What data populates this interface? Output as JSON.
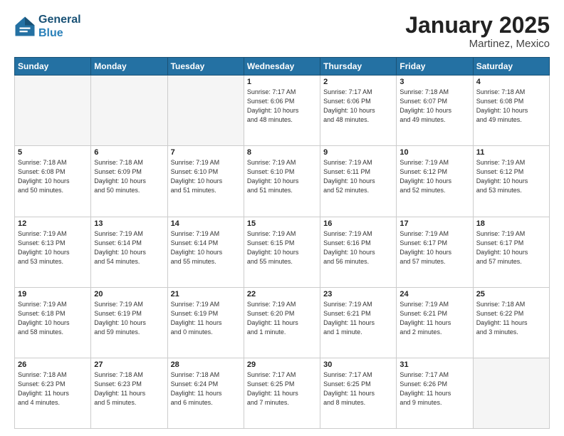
{
  "header": {
    "logo_line1": "General",
    "logo_line2": "Blue",
    "month": "January 2025",
    "location": "Martinez, Mexico"
  },
  "weekdays": [
    "Sunday",
    "Monday",
    "Tuesday",
    "Wednesday",
    "Thursday",
    "Friday",
    "Saturday"
  ],
  "weeks": [
    [
      {
        "day": "",
        "info": ""
      },
      {
        "day": "",
        "info": ""
      },
      {
        "day": "",
        "info": ""
      },
      {
        "day": "1",
        "info": "Sunrise: 7:17 AM\nSunset: 6:06 PM\nDaylight: 10 hours\nand 48 minutes."
      },
      {
        "day": "2",
        "info": "Sunrise: 7:17 AM\nSunset: 6:06 PM\nDaylight: 10 hours\nand 48 minutes."
      },
      {
        "day": "3",
        "info": "Sunrise: 7:18 AM\nSunset: 6:07 PM\nDaylight: 10 hours\nand 49 minutes."
      },
      {
        "day": "4",
        "info": "Sunrise: 7:18 AM\nSunset: 6:08 PM\nDaylight: 10 hours\nand 49 minutes."
      }
    ],
    [
      {
        "day": "5",
        "info": "Sunrise: 7:18 AM\nSunset: 6:08 PM\nDaylight: 10 hours\nand 50 minutes."
      },
      {
        "day": "6",
        "info": "Sunrise: 7:18 AM\nSunset: 6:09 PM\nDaylight: 10 hours\nand 50 minutes."
      },
      {
        "day": "7",
        "info": "Sunrise: 7:19 AM\nSunset: 6:10 PM\nDaylight: 10 hours\nand 51 minutes."
      },
      {
        "day": "8",
        "info": "Sunrise: 7:19 AM\nSunset: 6:10 PM\nDaylight: 10 hours\nand 51 minutes."
      },
      {
        "day": "9",
        "info": "Sunrise: 7:19 AM\nSunset: 6:11 PM\nDaylight: 10 hours\nand 52 minutes."
      },
      {
        "day": "10",
        "info": "Sunrise: 7:19 AM\nSunset: 6:12 PM\nDaylight: 10 hours\nand 52 minutes."
      },
      {
        "day": "11",
        "info": "Sunrise: 7:19 AM\nSunset: 6:12 PM\nDaylight: 10 hours\nand 53 minutes."
      }
    ],
    [
      {
        "day": "12",
        "info": "Sunrise: 7:19 AM\nSunset: 6:13 PM\nDaylight: 10 hours\nand 53 minutes."
      },
      {
        "day": "13",
        "info": "Sunrise: 7:19 AM\nSunset: 6:14 PM\nDaylight: 10 hours\nand 54 minutes."
      },
      {
        "day": "14",
        "info": "Sunrise: 7:19 AM\nSunset: 6:14 PM\nDaylight: 10 hours\nand 55 minutes."
      },
      {
        "day": "15",
        "info": "Sunrise: 7:19 AM\nSunset: 6:15 PM\nDaylight: 10 hours\nand 55 minutes."
      },
      {
        "day": "16",
        "info": "Sunrise: 7:19 AM\nSunset: 6:16 PM\nDaylight: 10 hours\nand 56 minutes."
      },
      {
        "day": "17",
        "info": "Sunrise: 7:19 AM\nSunset: 6:17 PM\nDaylight: 10 hours\nand 57 minutes."
      },
      {
        "day": "18",
        "info": "Sunrise: 7:19 AM\nSunset: 6:17 PM\nDaylight: 10 hours\nand 57 minutes."
      }
    ],
    [
      {
        "day": "19",
        "info": "Sunrise: 7:19 AM\nSunset: 6:18 PM\nDaylight: 10 hours\nand 58 minutes."
      },
      {
        "day": "20",
        "info": "Sunrise: 7:19 AM\nSunset: 6:19 PM\nDaylight: 10 hours\nand 59 minutes."
      },
      {
        "day": "21",
        "info": "Sunrise: 7:19 AM\nSunset: 6:19 PM\nDaylight: 11 hours\nand 0 minutes."
      },
      {
        "day": "22",
        "info": "Sunrise: 7:19 AM\nSunset: 6:20 PM\nDaylight: 11 hours\nand 1 minute."
      },
      {
        "day": "23",
        "info": "Sunrise: 7:19 AM\nSunset: 6:21 PM\nDaylight: 11 hours\nand 1 minute."
      },
      {
        "day": "24",
        "info": "Sunrise: 7:19 AM\nSunset: 6:21 PM\nDaylight: 11 hours\nand 2 minutes."
      },
      {
        "day": "25",
        "info": "Sunrise: 7:18 AM\nSunset: 6:22 PM\nDaylight: 11 hours\nand 3 minutes."
      }
    ],
    [
      {
        "day": "26",
        "info": "Sunrise: 7:18 AM\nSunset: 6:23 PM\nDaylight: 11 hours\nand 4 minutes."
      },
      {
        "day": "27",
        "info": "Sunrise: 7:18 AM\nSunset: 6:23 PM\nDaylight: 11 hours\nand 5 minutes."
      },
      {
        "day": "28",
        "info": "Sunrise: 7:18 AM\nSunset: 6:24 PM\nDaylight: 11 hours\nand 6 minutes."
      },
      {
        "day": "29",
        "info": "Sunrise: 7:17 AM\nSunset: 6:25 PM\nDaylight: 11 hours\nand 7 minutes."
      },
      {
        "day": "30",
        "info": "Sunrise: 7:17 AM\nSunset: 6:25 PM\nDaylight: 11 hours\nand 8 minutes."
      },
      {
        "day": "31",
        "info": "Sunrise: 7:17 AM\nSunset: 6:26 PM\nDaylight: 11 hours\nand 9 minutes."
      },
      {
        "day": "",
        "info": ""
      }
    ]
  ]
}
